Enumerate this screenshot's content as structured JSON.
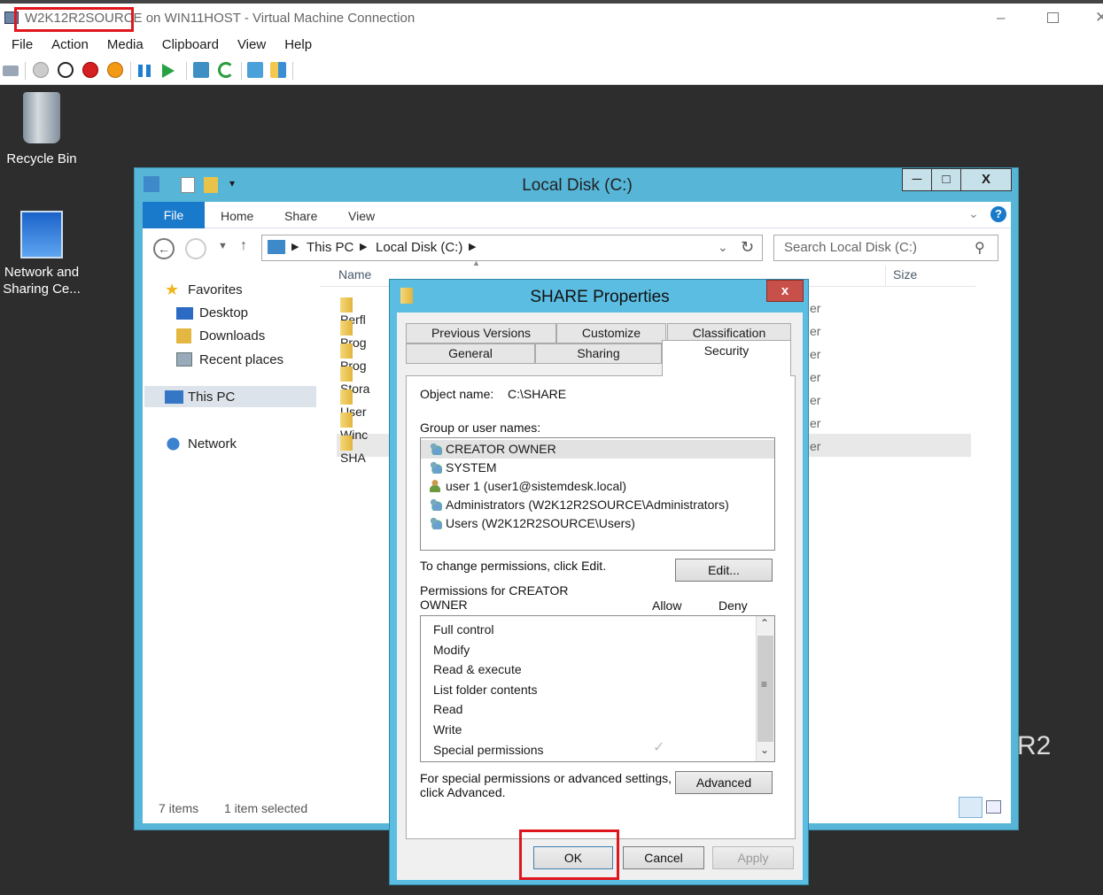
{
  "vm": {
    "title_name": "W2K12R2SOURCE",
    "title_rest": "on WIN11HOST - Virtual Machine Connection",
    "menu": [
      "File",
      "Action",
      "Media",
      "Clipboard",
      "View",
      "Help"
    ]
  },
  "desktop": {
    "recycle_bin": "Recycle Bin",
    "network_line1": "Network and",
    "network_line2": "Sharing Ce...",
    "watermark": "R2"
  },
  "explorer": {
    "title": "Local Disk (C:)",
    "tabs": [
      "File",
      "Home",
      "Share",
      "View"
    ],
    "address": [
      "This PC",
      "Local Disk (C:)"
    ],
    "search_placeholder": "Search Local Disk (C:)",
    "nav": {
      "favorites": "Favorites",
      "desktop": "Desktop",
      "downloads": "Downloads",
      "recent": "Recent places",
      "this_pc": "This PC",
      "network": "Network"
    },
    "columns": {
      "name": "Name",
      "size": "Size"
    },
    "files": [
      "Perfl",
      "Prog",
      "Prog",
      "Stora",
      "User",
      "Winc",
      "SHA"
    ],
    "type_suffix": "er",
    "status_items": "7 items",
    "status_selected": "1 item selected"
  },
  "dialog": {
    "title": "SHARE Properties",
    "close": "x",
    "tabs_back": [
      "Previous Versions",
      "Customize",
      "Classification"
    ],
    "tabs_front": [
      "General",
      "Sharing",
      "Security"
    ],
    "object_label": "Object name:",
    "object_value": "C:\\SHARE",
    "group_label": "Group or user names:",
    "users": [
      "CREATOR OWNER",
      "SYSTEM",
      "user 1 (user1@sistemdesk.local)",
      "Administrators (W2K12R2SOURCE\\Administrators)",
      "Users (W2K12R2SOURCE\\Users)"
    ],
    "change_text": "To change permissions, click Edit.",
    "edit_btn": "Edit...",
    "perm_label_1": "Permissions for CREATOR",
    "perm_label_2": "OWNER",
    "allow": "Allow",
    "deny": "Deny",
    "permissions": [
      "Full control",
      "Modify",
      "Read & execute",
      "List folder contents",
      "Read",
      "Write",
      "Special permissions"
    ],
    "special_1": "For special permissions or advanced settings,",
    "special_2": "click Advanced.",
    "advanced_btn": "Advanced",
    "ok": "OK",
    "cancel": "Cancel",
    "apply": "Apply"
  }
}
